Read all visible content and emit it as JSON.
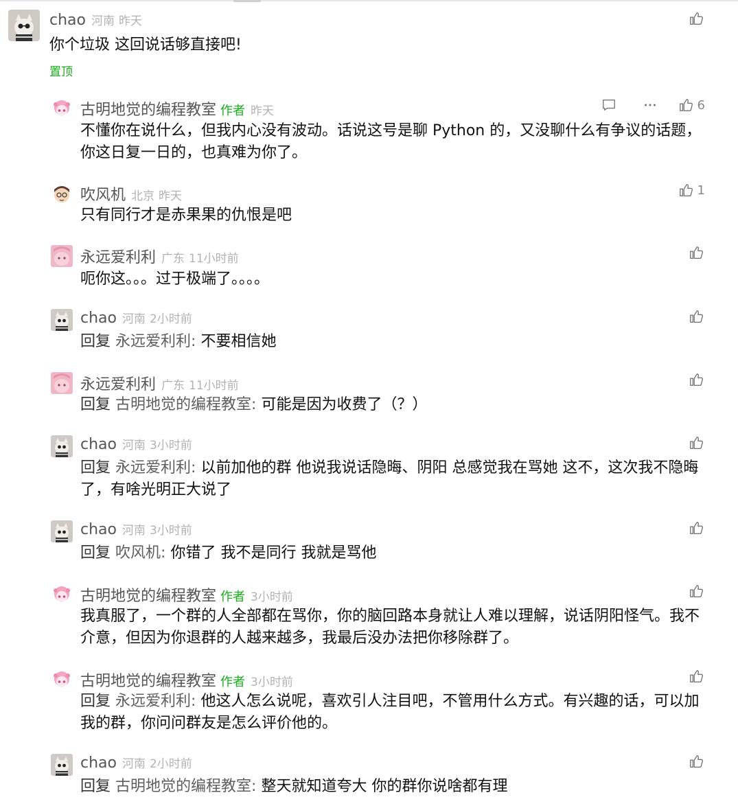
{
  "comments": [
    {
      "name": "chao",
      "author_tag": "",
      "location": "河南",
      "time": "昨天",
      "prefix": "",
      "target": "",
      "sep": "",
      "text": "你个垃圾  这回说话够直接吧!",
      "pinned_label": "置顶",
      "likes": "",
      "avatar": "cat-avatar"
    },
    {
      "name": "古明地觉的编程教室",
      "author_tag": "作者",
      "location": "",
      "time": "昨天",
      "prefix": "",
      "target": "",
      "sep": "",
      "text": "不懂你在说什么，但我内心没有波动。话说这号是聊 Python 的，又没聊什么有争议的话题，你这日复一日的，也真难为你了。",
      "likes": "6",
      "avatar": "anime-girl-avatar",
      "has_reply_icon": true,
      "has_more_icon": true
    },
    {
      "name": "吹风机",
      "author_tag": "",
      "location": "北京",
      "time": "昨天",
      "prefix": "",
      "target": "",
      "sep": "",
      "text": "只有同行才是赤果果的仇恨是吧",
      "likes": "1",
      "avatar": "cartoon-boy-avatar"
    },
    {
      "name": "永远爱利利",
      "author_tag": "",
      "location": "广东",
      "time": "11小时前",
      "prefix": "",
      "target": "",
      "sep": "",
      "text": "呃你这。。。过于极端了。。。。",
      "likes": "",
      "avatar": "pink-avatar"
    },
    {
      "name": "chao",
      "author_tag": "",
      "location": "河南",
      "time": "2小时前",
      "prefix": "回复",
      "target": "永远爱利利",
      "sep": ":",
      "text": "不要相信她",
      "likes": "",
      "avatar": "cat-avatar"
    },
    {
      "name": "永远爱利利",
      "author_tag": "",
      "location": "广东",
      "time": "11小时前",
      "prefix": "回复",
      "target": "古明地觉的编程教室",
      "sep": ":",
      "text": "可能是因为收费了（？）",
      "likes": "",
      "avatar": "pink-avatar"
    },
    {
      "name": "chao",
      "author_tag": "",
      "location": "河南",
      "time": "3小时前",
      "prefix": "回复",
      "target": "永远爱利利",
      "sep": ":",
      "text": "以前加他的群 他说我说话隐晦、阴阳  总感觉我在骂她  这不，这次我不隐晦了，有啥光明正大说了",
      "likes": "",
      "avatar": "cat-avatar"
    },
    {
      "name": "chao",
      "author_tag": "",
      "location": "河南",
      "time": "3小时前",
      "prefix": "回复",
      "target": "吹风机",
      "sep": ":",
      "text": "你错了  我不是同行  我就是骂他",
      "likes": "",
      "avatar": "cat-avatar"
    },
    {
      "name": "古明地觉的编程教室",
      "author_tag": "作者",
      "location": "",
      "time": "3小时前",
      "prefix": "",
      "target": "",
      "sep": "",
      "text": "我真服了，一个群的人全部都在骂你，你的脑回路本身就让人难以理解，说话阴阳怪气。我不介意，但因为你退群的人越来越多，我最后没办法把你移除群了。",
      "likes": "",
      "avatar": "anime-girl-avatar"
    },
    {
      "name": "古明地觉的编程教室",
      "author_tag": "作者",
      "location": "",
      "time": "3小时前",
      "prefix": "回复",
      "target": "永远爱利利",
      "sep": ":",
      "text": "他这人怎么说呢，喜欢引人注目吧，不管用什么方式。有兴趣的话，可以加我的群，你问问群友是怎么评价他的。",
      "likes": "",
      "avatar": "anime-girl-avatar"
    },
    {
      "name": "chao",
      "author_tag": "",
      "location": "河南",
      "time": "2小时前",
      "prefix": "回复",
      "target": "古明地觉的编程教室",
      "sep": ":",
      "text": "整天就知道夸大   你的群你说啥都有理",
      "likes": "",
      "avatar": "cat-avatar"
    }
  ],
  "icons": {
    "like": "thumbs-up-icon",
    "reply": "comment-bubble-icon",
    "more": "more-dots-icon"
  },
  "colors": {
    "author_green": "#1aad19",
    "meta_gray": "#b2b2b2",
    "name_gray": "#555555"
  }
}
